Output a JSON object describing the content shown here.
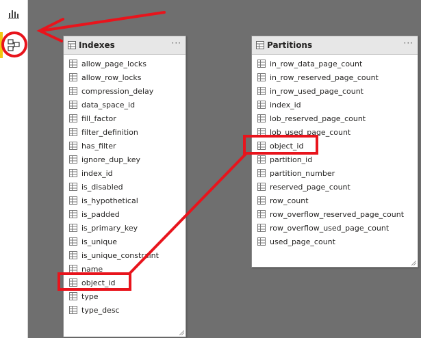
{
  "sidebar": {
    "items": [
      {
        "icon": "bar-chart-icon"
      },
      {
        "icon": "model-view-icon"
      }
    ],
    "accent_color": "#f2c811"
  },
  "indexes": {
    "title": "Indexes",
    "fields": [
      "allow_page_locks",
      "allow_row_locks",
      "compression_delay",
      "data_space_id",
      "fill_factor",
      "filter_definition",
      "has_filter",
      "ignore_dup_key",
      "index_id",
      "is_disabled",
      "is_hypothetical",
      "is_padded",
      "is_primary_key",
      "is_unique",
      "is_unique_constraint",
      "name",
      "object_id",
      "type",
      "type_desc"
    ]
  },
  "partitions": {
    "title": "Partitions",
    "fields": [
      "in_row_data_page_count",
      "in_row_reserved_page_count",
      "in_row_used_page_count",
      "index_id",
      "lob_reserved_page_count",
      "lob_used_page_count",
      "object_id",
      "partition_id",
      "partition_number",
      "reserved_page_count",
      "row_count",
      "row_overflow_reserved_page_count",
      "row_overflow_used_page_count",
      "used_page_count"
    ]
  },
  "annotation": {
    "color": "#e8141c",
    "highlighted_field": "object_id"
  },
  "more_label": "···"
}
